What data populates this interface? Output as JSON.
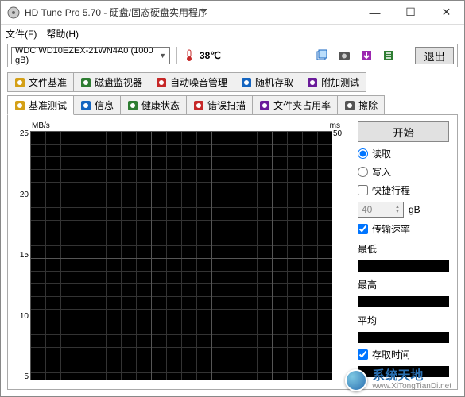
{
  "window": {
    "title": "HD Tune Pro 5.70 - 硬盘/固态硬盘实用程序",
    "controls": {
      "min": "—",
      "max": "☐",
      "close": "✕"
    }
  },
  "menu": {
    "file": "文件(F)",
    "help": "帮助(H)"
  },
  "toolbar": {
    "drive": "WDC WD10EZEX-21WN4A0 (1000 gB)",
    "temp": "38℃",
    "exit": "退出"
  },
  "tabs_top": [
    {
      "label": "文件基准",
      "color": "#d4a017"
    },
    {
      "label": "磁盘监视器",
      "color": "#2e7d32"
    },
    {
      "label": "自动噪音管理",
      "color": "#c62828"
    },
    {
      "label": "随机存取",
      "color": "#1565c0"
    },
    {
      "label": "附加测试",
      "color": "#6a1b9a"
    }
  ],
  "tabs_bottom": [
    {
      "label": "基准测试",
      "color": "#d4a017",
      "active": true
    },
    {
      "label": "信息",
      "color": "#1565c0"
    },
    {
      "label": "健康状态",
      "color": "#2e7d32"
    },
    {
      "label": "错误扫描",
      "color": "#c62828"
    },
    {
      "label": "文件夹占用率",
      "color": "#6a1b9a"
    },
    {
      "label": "擦除",
      "color": "#555"
    }
  ],
  "chart_data": {
    "type": "line",
    "title": "",
    "xlabel": "",
    "y_left_label": "MB/s",
    "y_right_label": "ms",
    "y_left_ticks": [
      25,
      20,
      15,
      10,
      5
    ],
    "y_right_ticks": [
      50
    ],
    "ylim_left": [
      0,
      25
    ],
    "ylim_right": [
      0,
      50
    ],
    "series": []
  },
  "side": {
    "start": "开始",
    "mode_read": "读取",
    "mode_write": "写入",
    "shortstroke": "快捷行程",
    "shortstroke_value": "40",
    "shortstroke_unit": "gB",
    "transfer_rate": "传输速率",
    "stat_min": "最低",
    "stat_max": "最高",
    "stat_avg": "平均",
    "access_time": "存取时间"
  },
  "watermark": {
    "main": "系统天地",
    "sub": "www.XiTongTianDi.net"
  }
}
